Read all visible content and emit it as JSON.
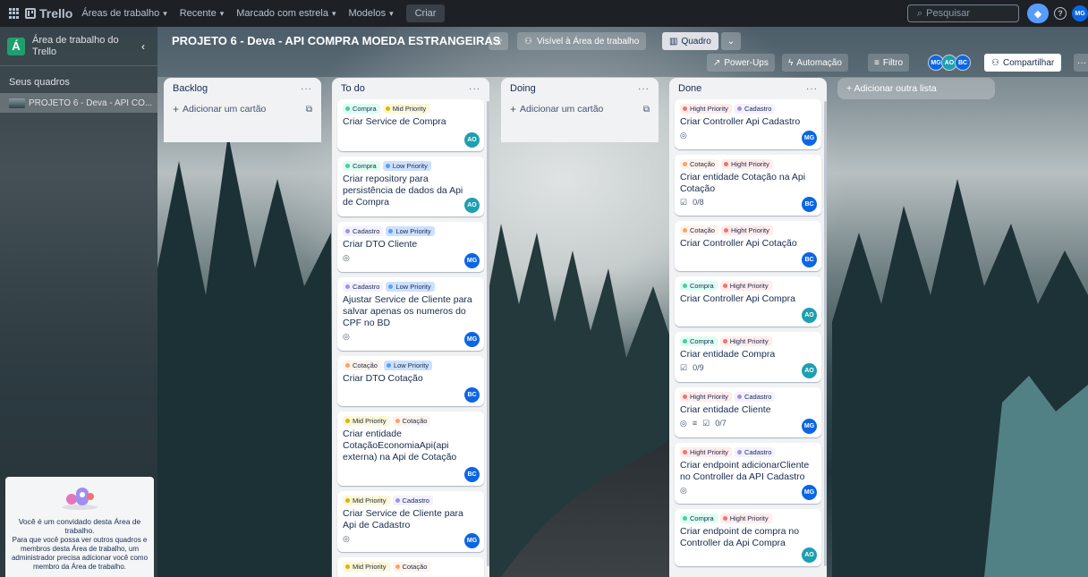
{
  "topnav": {
    "logo": "Trello",
    "items": [
      {
        "label": "Áreas de trabalho"
      },
      {
        "label": "Recente"
      },
      {
        "label": "Marcado com estrela"
      },
      {
        "label": "Modelos"
      }
    ],
    "create_label": "Criar",
    "search_placeholder": "Pesquisar",
    "user_initials": "MG"
  },
  "sidebar": {
    "workspace_badge": "Á",
    "workspace_name": "Área de trabalho do Trello",
    "section_title": "Seus quadros",
    "boards": [
      {
        "name": "PROJETO 6 - Deva - API CO..."
      }
    ],
    "guest_title": "Você é um convidado desta Área de trabalho.",
    "guest_text": "Para que você possa ver outros quadros e membros desta Área de trabalho, um administrador precisa adicionar você como membro da Área de trabalho."
  },
  "board": {
    "title": "PROJETO 6 - Deva - API COMPRA MOEDA ESTRANGEIRAS",
    "visibility": "Visível à Área de trabalho",
    "view": "Quadro",
    "powerups": "Power-Ups",
    "automation": "Automação",
    "filter": "Filtro",
    "members": [
      "MG",
      "AO",
      "BC"
    ],
    "share": "Compartilhar",
    "add_list": "+ Adicionar outra lista"
  },
  "labels": {
    "compra": "Compra",
    "mid": "Mid Priority",
    "low": "Low Priority",
    "cadastro": "Cadastro",
    "cotacao": "Cotação",
    "high": "Hight Priority"
  },
  "add_card_label": "Adicionar um cartão",
  "lists": [
    {
      "title": "Backlog"
    },
    {
      "title": "To do",
      "cards": [
        {
          "title": "Criar Service de Compra",
          "member": "AO"
        },
        {
          "title": "Criar repository para persistência de dados da Api de Compra",
          "member": "AO"
        },
        {
          "title": "Criar DTO Cliente",
          "member": "MG"
        },
        {
          "title": "Ajustar Service de Cliente para salvar apenas os numeros do CPF no BD",
          "member": "MG"
        },
        {
          "title": "Criar DTO Cotação",
          "member": "BC"
        },
        {
          "title": "Criar entidade CotaçãoEconomiaApi(api externa) na Api de Cotação",
          "member": "BC"
        },
        {
          "title": "Criar Service de Cliente para Api de Cadastro",
          "member": "MG"
        }
      ]
    },
    {
      "title": "Doing"
    },
    {
      "title": "Done",
      "cards": [
        {
          "title": "Criar Controller Api Cadastro",
          "member": "MG"
        },
        {
          "title": "Criar entidade Cotação na Api Cotação",
          "member": "BC",
          "checklist": "0/8"
        },
        {
          "title": "Criar Controller Api Cotação",
          "member": "BC"
        },
        {
          "title": "Criar Controller Api Compra",
          "member": "AO"
        },
        {
          "title": "Criar entidade Compra",
          "member": "AO",
          "checklist": "0/9"
        },
        {
          "title": "Criar entidade Cliente",
          "member": "MG",
          "checklist": "0/7"
        },
        {
          "title": "Criar endpoint adicionarCliente no Controller da API Cadastro",
          "member": "MG"
        },
        {
          "title": "Criar endpoint de compra no Controller da Api Compra",
          "member": "AO"
        }
      ]
    }
  ],
  "colors": {
    "topnav_bg": "#1d2125",
    "list_bg": "#f1f2f4",
    "avatar_blue": "#0c66e4",
    "avatar_teal": "#1f9fb0",
    "workspace_green": "#1f9f6e"
  }
}
